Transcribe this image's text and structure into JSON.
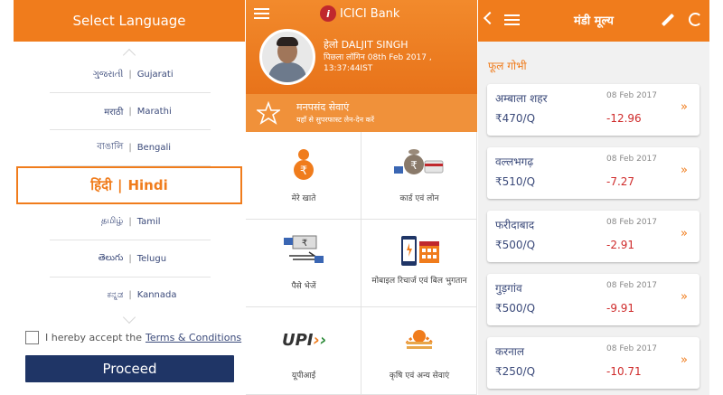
{
  "language_screen": {
    "title": "Select Language",
    "languages": [
      {
        "native": "ગુજરાતી",
        "english": "Gujarati"
      },
      {
        "native": "मराठी",
        "english": "Marathi"
      },
      {
        "native": "বাঙালি",
        "english": "Bengali"
      },
      {
        "native": "हिंदी",
        "english": "Hindi"
      },
      {
        "native": "தமிழ்",
        "english": "Tamil"
      },
      {
        "native": "తెలుగు",
        "english": "Telugu"
      },
      {
        "native": "ಕನ್ನಡ",
        "english": "Kannada"
      }
    ],
    "separator": "|",
    "terms_prefix": "I hereby accept the",
    "terms_link": "Terms & Conditions",
    "proceed_label": "Proceed"
  },
  "bank_screen": {
    "brand": "ICICI Bank",
    "brand_letter": "i",
    "greeting": "हेलो DALJIT SINGH",
    "last_login": "पिछला लॉगिन 08th Feb 2017 , 13:37:44IST",
    "favorites_title": "मनपसंद सेवाएं",
    "favorites_subtitle": "यहाँ से सुपरफास्ट लेन-देन करें",
    "tiles": [
      {
        "label": "मेरे खाते",
        "icon": "rupee-person-icon"
      },
      {
        "label": "कार्ड एवं लोन",
        "icon": "card-loan-icon"
      },
      {
        "label": "पैसे भेजें",
        "icon": "send-money-icon"
      },
      {
        "label": "मोबाइल रिचार्ज एवं बिल भुगतान",
        "icon": "mobile-bill-icon"
      },
      {
        "label": "यूपीआई",
        "icon": "upi-icon"
      },
      {
        "label": "कृषि एवं अन्य सेवाएं",
        "icon": "agri-icon"
      }
    ],
    "upi_logo_text": "UPI"
  },
  "mandi_screen": {
    "title": "मंडी मूल्य",
    "category": "फूल गोभी",
    "markets": [
      {
        "place": "अम्बाला शहर",
        "date": "08 Feb 2017",
        "price": "₹470/Q",
        "change": "-12.96"
      },
      {
        "place": "वल्लभगढ़",
        "date": "08 Feb 2017",
        "price": "₹510/Q",
        "change": "-7.27"
      },
      {
        "place": "फरीदाबाद",
        "date": "08 Feb 2017",
        "price": "₹500/Q",
        "change": "-2.91"
      },
      {
        "place": "गुड़गांव",
        "date": "08 Feb 2017",
        "price": "₹500/Q",
        "change": "-9.91"
      },
      {
        "place": "करनाल",
        "date": "08 Feb 2017",
        "price": "₹250/Q",
        "change": "-10.71"
      }
    ],
    "arrow_glyph": "»"
  },
  "colors": {
    "accent": "#f07c1c",
    "navy": "#1f3566",
    "negative": "#cf2a2a"
  }
}
